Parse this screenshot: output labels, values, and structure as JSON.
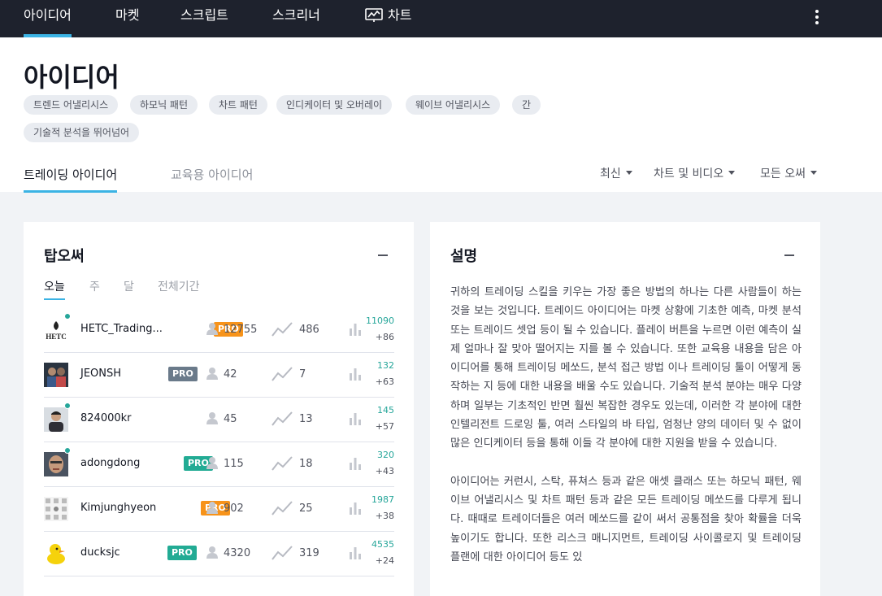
{
  "nav": {
    "items": [
      "아이디어",
      "마켓",
      "스크립트",
      "스크리너",
      "차트"
    ],
    "active_index": 0
  },
  "header": {
    "title": "아이디어",
    "tags": [
      "트렌드 어낼리시스",
      "하모닉 패턴",
      "차트 패턴",
      "인디케이터 및 오버레이",
      "웨이브 어낼리시스",
      "간",
      "기술적 분석을 뛰어넘어"
    ],
    "tabs": [
      "트레이딩 아이디어",
      "교육용 아이디어"
    ],
    "filters": [
      "최신",
      "차트 및 비디오",
      "모든 오써"
    ]
  },
  "top_authors": {
    "title": "탑오써",
    "periods": [
      "오늘",
      "주",
      "달",
      "전체기간"
    ],
    "rows": [
      {
        "username": "HETC_Trading...",
        "pro": "PRO",
        "pro_color": "orange",
        "followers": "12755",
        "ideas": "486",
        "score": "11090",
        "delta": "+86",
        "online": true,
        "avatar": "HETC"
      },
      {
        "username": "JEONSH",
        "pro": "PRO",
        "pro_color": "gray",
        "followers": "42",
        "ideas": "7",
        "score": "132",
        "delta": "+63",
        "online": false,
        "avatar": "photo-dark"
      },
      {
        "username": "824000kr",
        "pro": "",
        "pro_color": "",
        "followers": "45",
        "ideas": "13",
        "score": "145",
        "delta": "+57",
        "online": true,
        "avatar": "photo-person"
      },
      {
        "username": "adongdong",
        "pro": "PRO",
        "pro_color": "green",
        "followers": "115",
        "ideas": "18",
        "score": "320",
        "delta": "+43",
        "online": true,
        "avatar": "photo-face"
      },
      {
        "username": "Kimjunghyeon",
        "pro": "PRO",
        "pro_color": "orange",
        "followers": "902",
        "ideas": "25",
        "score": "1987",
        "delta": "+38",
        "online": false,
        "avatar": "pattern"
      },
      {
        "username": "ducksjc",
        "pro": "PRO",
        "pro_color": "green",
        "followers": "4320",
        "ideas": "319",
        "score": "4535",
        "delta": "+24",
        "online": false,
        "avatar": "duck"
      }
    ]
  },
  "description": {
    "title": "설명",
    "paragraphs": [
      "귀하의 트레이딩 스킬을 키우는 가장 좋은 방법의 하나는 다른 사람들이 하는 것을 보는 것입니다. 트레이드 아이디어는 마켓 상황에 기초한 예측, 마켓 분석 또는 트레이드 셋업 등이 될 수 있습니다. 플레이 버튼을 누르면 이런 예측이 실제 얼마나 잘 맞아 떨어지는 지를 볼 수 있습니다. 또한 교육용 내용을 담은 아이디어를 통해 트레이딩 메쏘드, 분석 접근 방법 이나 트레이딩 툴이 어떻게 동작하는 지 등에 대한 내용을 배울 수도 있습니다. 기술적 분석 분야는 매우 다양하며 일부는 기초적인 반면 훨씬 복잡한 경우도 있는데, 이러한 각 분야에 대한 인텔리전트 드로잉 툴, 여러 스타일의 바 타입, 엄청난 양의 데이터 및 수 없이 많은 인디케이터 등을 통해 이들 각 분야에 대한 지원을 받을 수 있습니다.",
      "아이디어는 커런시, 스탁, 퓨쳐스 등과 같은 애셋 클래스 또는 하모닉 패턴, 웨이브 어낼리시스 및 차트 패턴 등과 같은 모든 트레이딩 메쏘드를 다루게 됩니다. 때때로 트레이더들은 여러 메쏘드를 같이 써서 공통점을 찾아 확률을 더욱 높이기도 합니다. 또한 리스크 매니지먼트, 트레이딩 사이콜로지 및 트레이딩 플랜에 대한 아이디어 등도 있"
    ]
  },
  "colors": {
    "nav_bg": "#1e222d",
    "accent": "#3bb3e4",
    "score_green": "#26a69a",
    "pro_orange": "#f7931a",
    "pro_gray": "#6a7a8a",
    "pro_green": "#22ab94"
  }
}
